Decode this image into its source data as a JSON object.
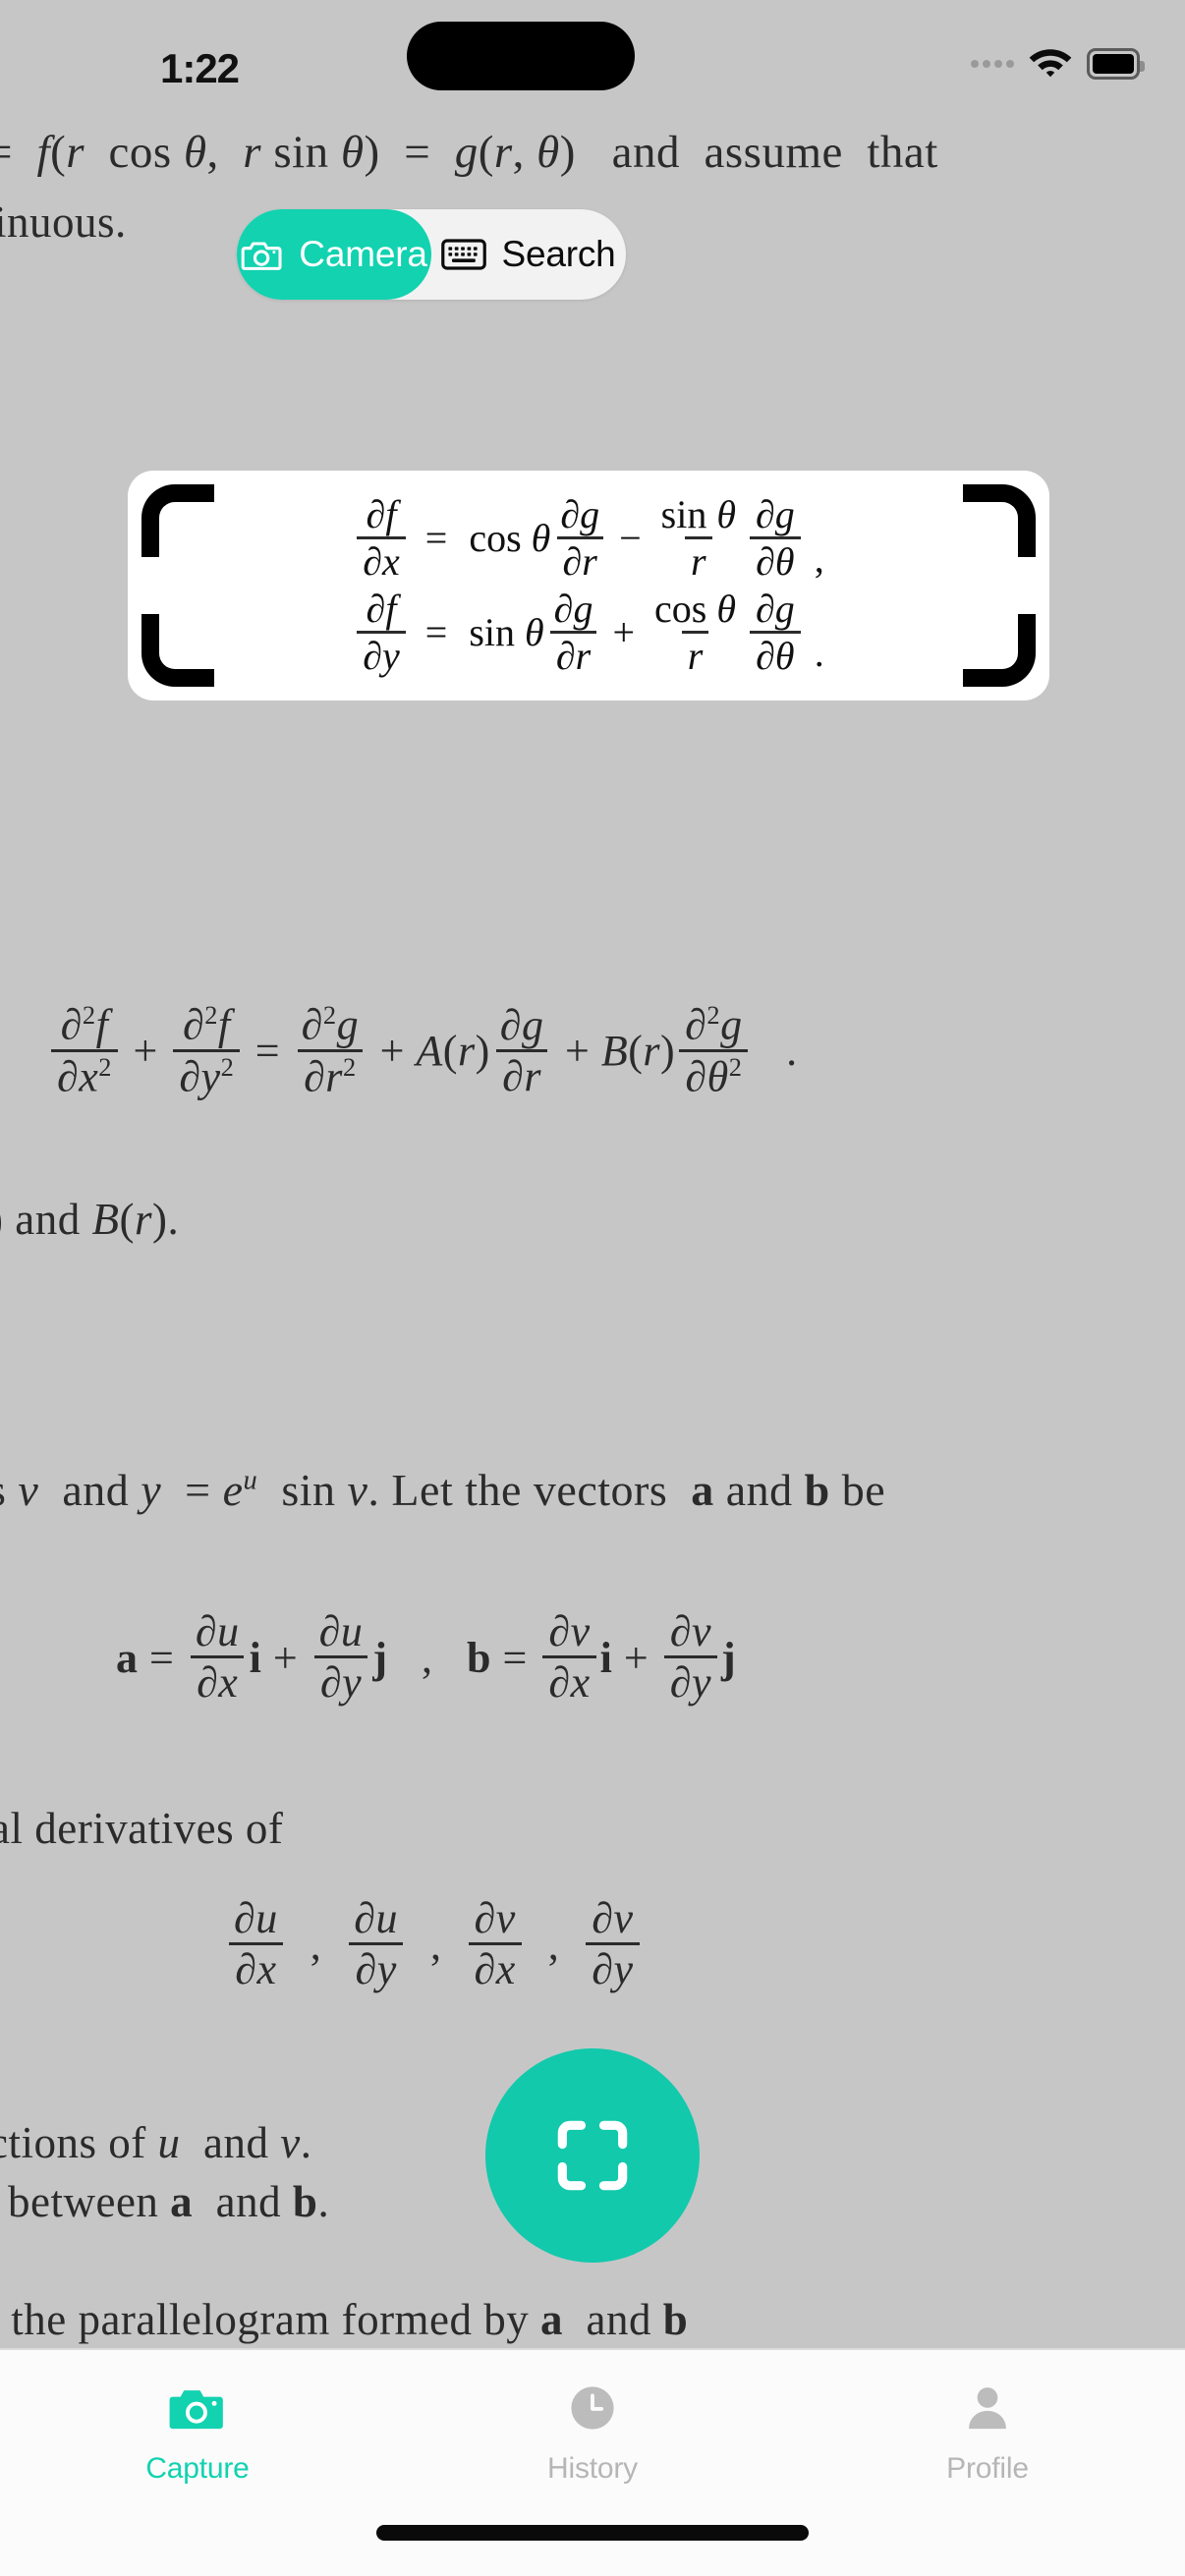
{
  "status_bar": {
    "time": "1:22",
    "signal_icon": "signal-dots-icon",
    "wifi_icon": "wifi-icon",
    "battery_icon": "battery-full-icon"
  },
  "mode_switch": {
    "camera": {
      "label": "Camera",
      "icon": "camera-icon",
      "selected": true
    },
    "search": {
      "label": "Search",
      "icon": "keyboard-icon",
      "selected": false
    },
    "active_color": "#12D2B0",
    "track_color": "#F2F2F2"
  },
  "scan_button": {
    "icon": "scan-frame-icon",
    "color": "#12C9AC",
    "label": "Scan"
  },
  "tab_bar": {
    "items": [
      {
        "label": "Capture",
        "icon": "camera-icon",
        "active": true
      },
      {
        "label": "History",
        "icon": "clock-icon",
        "active": false
      },
      {
        "label": "Profile",
        "icon": "person-icon",
        "active": false
      }
    ],
    "active_color": "#12D2B0",
    "inactive_color": "#B6B6B6"
  },
  "document": {
    "background_color": "#C6C6C6",
    "line_1": "= f(r cos θ, r sin θ) = g(r, θ)  and  assume that",
    "line_2": "inuous.",
    "line_3": ") and B(r).",
    "line_4": "s v and y = e^u sin v. Let the vectors a and b be",
    "line_5": "al derivatives of",
    "line_6": "ctions of u and v.",
    "line_7": "between a and b.",
    "line_8": "of the parallelogram formed by a and b",
    "equations": {
      "captured_card": {
        "row_1": "∂f/∂x = cos θ ∂g/∂r − (sin θ / r) ∂g/∂θ ,",
        "row_2": "∂f/∂y = sin θ ∂g/∂r + (cos θ / r) ∂g/∂θ ."
      },
      "laplacian": "∂²f/∂x² + ∂²f/∂y² = ∂²g/∂r² + A(r) ∂g/∂r + B(r) ∂²g/∂θ² .",
      "vectors": "a = ∂u/∂x i + ∂u/∂y j  ,  b = ∂v/∂x i + ∂v/∂y j",
      "partials_list": "∂u/∂x , ∂u/∂y , ∂v/∂x , ∂v/∂y"
    },
    "symbols": {
      "partial": "∂",
      "theta": "θ",
      "f": "f",
      "g": "g",
      "r": "r",
      "x": "x",
      "y": "y",
      "u": "u",
      "v": "v",
      "A": "A",
      "B": "B",
      "i": "i",
      "j": "j",
      "a": "a",
      "b": "b",
      "two": "2",
      "eq": "=",
      "plus": "+",
      "minus": "−",
      "comma": ",",
      "period": ".",
      "cos": "cos",
      "sin": "sin",
      "lparen": "(",
      "rparen": ")",
      "e": "e",
      "and": "and",
      "assume_that": "and  assume  that",
      "inuous": "inuous.",
      "tail_and_Br": ") and ",
      "Br_tail": "(r).",
      "let_the_vectors": ". Let the vectors ",
      "be": " be",
      "s_v_and": "s v and y = ",
      "sin_v": " sin v",
      "al_derivatives_of": "al derivatives of",
      "ctions_of": "ctions of ",
      "u_and_v": " and ",
      "between": "between ",
      "parallelogram": "f the parallelogram formed by "
    }
  }
}
